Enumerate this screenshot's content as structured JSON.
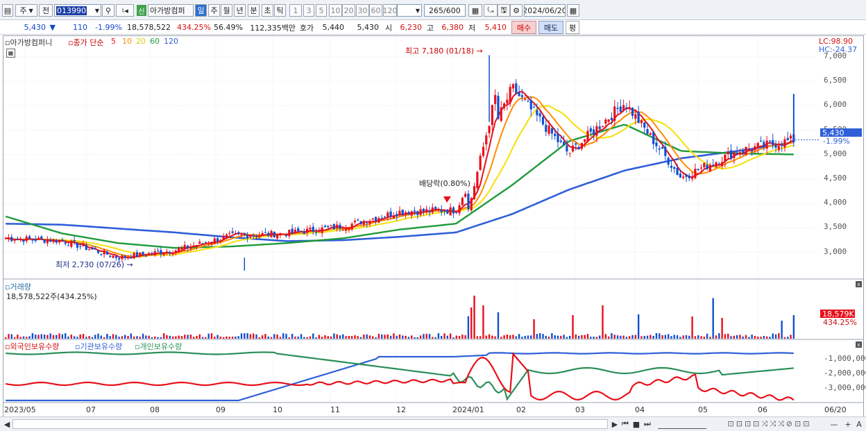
{
  "toolbar": {
    "code_type": "주",
    "prev_label": "전",
    "code_value": "013990",
    "name_badge": "신",
    "stock_name": "아가방컴퍼",
    "periods": [
      "일",
      "주",
      "월",
      "년",
      "분",
      "초",
      "틱"
    ],
    "active_period": "일",
    "intervals": [
      "1",
      "3",
      "5",
      "10",
      "20",
      "30",
      "60",
      "120"
    ],
    "count_value": "265",
    "count_total": "/600",
    "date_value": "2024/06/20"
  },
  "quote": {
    "price": "5,430",
    "arrow": "▼",
    "change": "110",
    "change_pct": "-1.99%",
    "volume": "18,578,522",
    "volume_ratio": "434.25%",
    "turnover": "56.49%",
    "amount": "112,335백만",
    "hoga_label": "호가",
    "hoga_ask": "5,440",
    "hoga_bid": "5,430",
    "open_label": "시",
    "open": "6,230",
    "high_label": "고",
    "high": "6,380",
    "low_label": "저",
    "low": "5,410",
    "buy_label": "매수",
    "sell_label": "매도",
    "eval_label": "평"
  },
  "price_panel": {
    "legend_name": "아가방컴퍼니",
    "legend_prefix": "종가 단순",
    "ma_periods": [
      "5",
      "10",
      "20",
      "60",
      "120"
    ],
    "lc": "LC:98.90",
    "hc": "HC:-24.37",
    "ticks": [
      "7,000",
      "6,500",
      "6,000",
      "5,500",
      "5,000",
      "4,500",
      "4,000",
      "3,500",
      "3,000"
    ],
    "current_price": "5,430",
    "current_pct": "-1.99%",
    "high_annotation": "최고 7,180 (01/18)",
    "low_annotation": "최저 2,730 (07/26)",
    "dividend_annotation": "배당락(0.80%)"
  },
  "volume_panel": {
    "title": "거래량",
    "value": "18,578,522주(434.25%)",
    "current": "18,579K",
    "current_pct": "434.25%"
  },
  "holdings_panel": {
    "series": [
      "외국인보유수량",
      "기관보유수량",
      "개인보유수량"
    ],
    "ticks": [
      "-1,000,000",
      "-2,000,000",
      "-3,000,000"
    ]
  },
  "xaxis": {
    "labels": [
      "2023/05",
      "07",
      "08",
      "09",
      "10",
      "11",
      "12",
      "2024/01",
      "02",
      "03",
      "04",
      "05",
      "06"
    ],
    "right_label": "06/20"
  },
  "colors": {
    "up": "#e8101a",
    "down": "#1050d0",
    "ma5": "#e8101a",
    "ma10": "#ff8c00",
    "ma20": "#f5e21a",
    "ma60": "#1f9a3a",
    "ma120": "#2f5fd8",
    "foreign": "#e8101a",
    "inst": "#2f5fd8",
    "indiv": "#2a8f58",
    "accent_selected": "#cfe0f8"
  },
  "chart_data": {
    "type": "candlestick",
    "dates": [
      "2023-05",
      "2023-06",
      "2023-07",
      "2023-08",
      "2023-09",
      "2023-10",
      "2023-11",
      "2023-12",
      "2024-01-02",
      "2024-01-18",
      "2024-02",
      "2024-03",
      "2024-04",
      "2024-05",
      "2024-06-20"
    ],
    "close": [
      3400,
      3350,
      3000,
      3150,
      3450,
      3500,
      3650,
      3950,
      3980,
      6500,
      5150,
      6200,
      4650,
      5200,
      5430
    ],
    "ma60": [
      3850,
      3500,
      3300,
      3200,
      3230,
      3300,
      3400,
      3580,
      3700,
      4500,
      5400,
      5750,
      5200,
      5150,
      5130
    ],
    "ma120": [
      3700,
      3680,
      3600,
      3520,
      3420,
      3340,
      3360,
      3430,
      3520,
      3900,
      4400,
      4800,
      5050,
      5200,
      5380
    ],
    "high_point": {
      "date": "2024-01-18",
      "value": 7180
    },
    "low_point": {
      "date": "2023-07-26",
      "value": 2730
    },
    "ylim": [
      2600,
      7200
    ]
  }
}
